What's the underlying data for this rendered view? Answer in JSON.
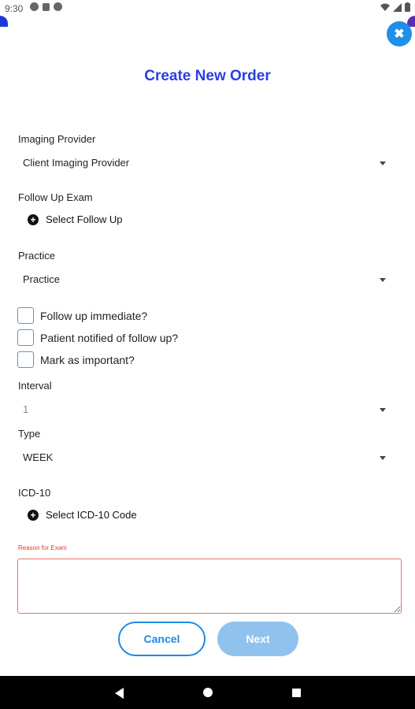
{
  "status_bar": {
    "time": "9:30",
    "left_icons": [
      "app-icon",
      "sim-icon",
      "media-icon"
    ],
    "right_icons": [
      "wifi-icon",
      "signal-icon",
      "battery-icon"
    ]
  },
  "header": {
    "title": "Create New Order",
    "close_icon": "close-icon",
    "close_glyph": "✖"
  },
  "form": {
    "imaging_provider": {
      "label": "Imaging Provider",
      "value": "Client Imaging Provider"
    },
    "follow_up_exam": {
      "label": "Follow Up Exam",
      "action": "Select Follow Up"
    },
    "practice": {
      "label": "Practice",
      "value": "Practice"
    },
    "checkboxes": [
      {
        "label": "Follow up immediate?",
        "checked": false
      },
      {
        "label": "Patient notified of follow up?",
        "checked": false
      },
      {
        "label": "Mark as important?",
        "checked": false
      }
    ],
    "interval": {
      "label": "Interval",
      "value": "1"
    },
    "type": {
      "label": "Type",
      "value": "WEEK"
    },
    "icd10": {
      "label": "ICD-10",
      "action": "Select ICD-10 Code"
    },
    "reason": {
      "label": "Reason for Exam",
      "value": ""
    }
  },
  "buttons": {
    "cancel": "Cancel",
    "next": "Next"
  },
  "colors": {
    "title": "#2a3fe0",
    "close_button": "#1f8fe8",
    "cancel_border": "#1e88e5",
    "next_disabled": "#8fc3ee",
    "error": "#e53935"
  },
  "nav_bar": {
    "icons": [
      "back-icon",
      "home-icon",
      "recents-icon"
    ]
  }
}
